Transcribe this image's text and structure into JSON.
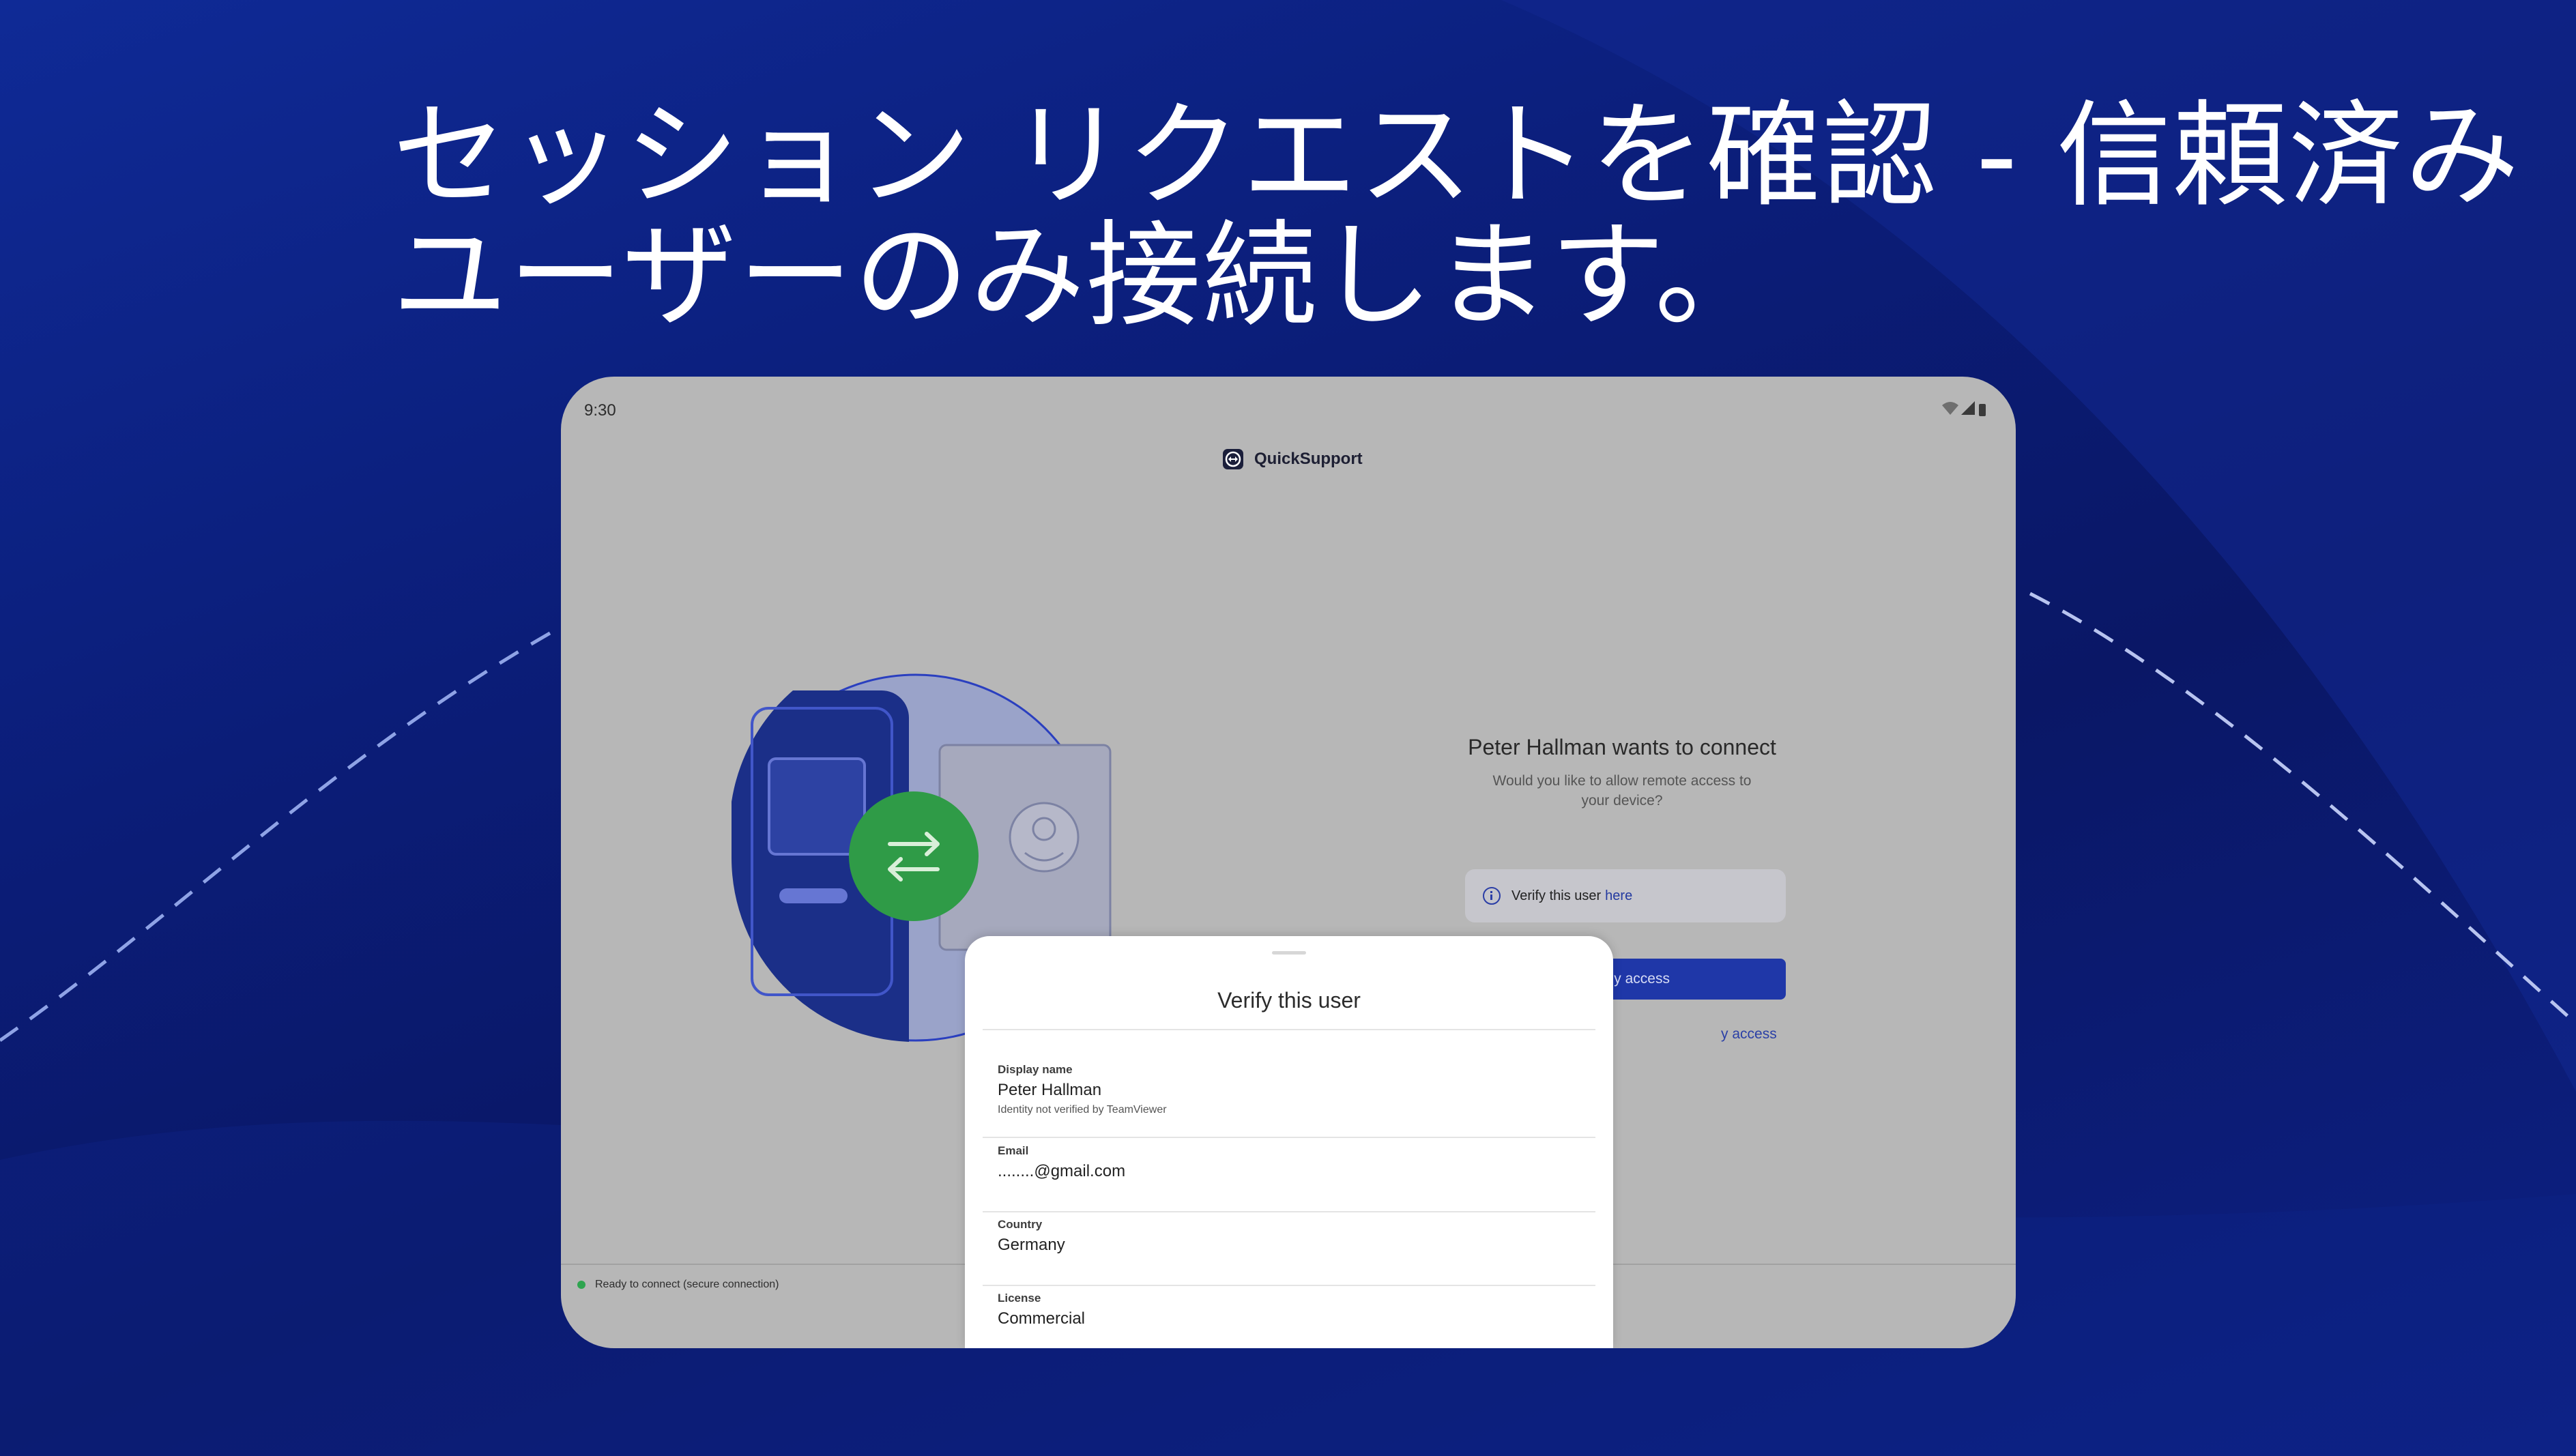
{
  "headline": {
    "line1": "セッション リクエストを確認 - 信頼済み",
    "line2": "ユーザーのみ接続します。"
  },
  "device": {
    "status_time": "9:30",
    "app_name": "QuickSupport",
    "connect_title": "Peter Hallman wants to connect",
    "connect_subtitle": "Would you like to allow remote access to your device?",
    "verify_text": "Verify this user",
    "verify_link": "here",
    "allow_button": "y access",
    "deny_link": "y access",
    "footer_status": "Ready to connect (secure connection)"
  },
  "sheet": {
    "title": "Verify this user",
    "fields": [
      {
        "label": "Display name",
        "value": "Peter Hallman",
        "note": "Identity not verified by TeamViewer"
      },
      {
        "label": "Email",
        "value": "........@gmail.com"
      },
      {
        "label": "Country",
        "value": "Germany"
      },
      {
        "label": "License",
        "value": "Commercial"
      }
    ]
  },
  "colors": {
    "background": "#0b1d78",
    "primary_button": "#1f37a8",
    "swap_circle": "#2f9b47",
    "status_ok": "#2ea44f"
  }
}
